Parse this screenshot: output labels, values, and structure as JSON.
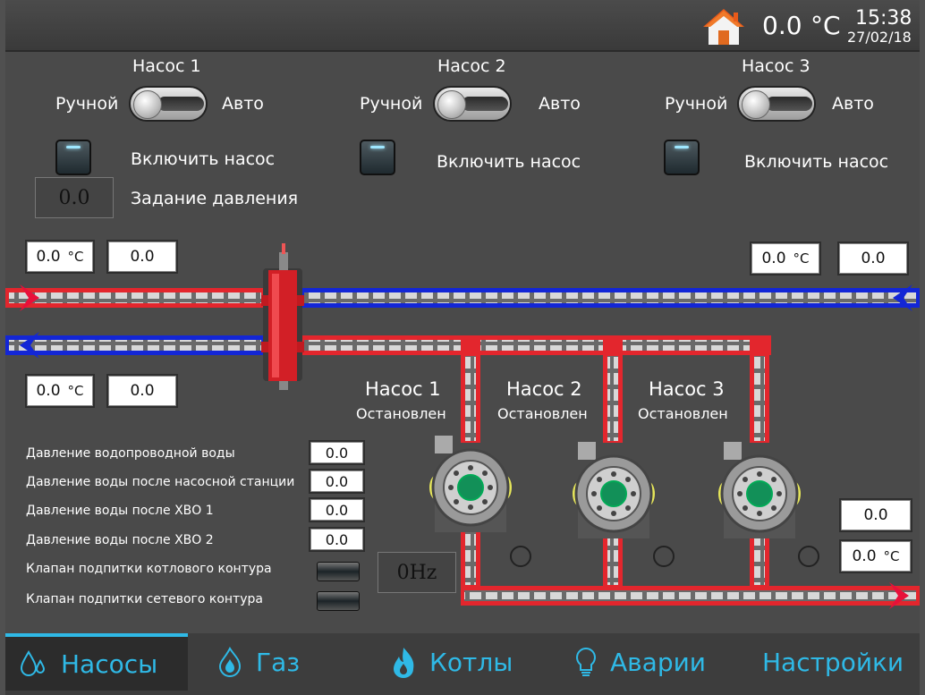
{
  "header": {
    "temperature": "0.0",
    "temp_unit": "°C",
    "time": "15:38",
    "date": "27/02/18"
  },
  "pumps_control": [
    {
      "title": "Насос 1",
      "manual": "Ручной",
      "auto": "Авто",
      "enable": "Включить насос"
    },
    {
      "title": "Насос 2",
      "manual": "Ручной",
      "auto": "Авто",
      "enable": "Включить насос"
    },
    {
      "title": "Насос 3",
      "manual": "Ручной",
      "auto": "Авто",
      "enable": "Включить насос"
    }
  ],
  "pressure_setpoint": {
    "label": "Задание давления",
    "value": "0.0"
  },
  "loop_readings": {
    "left_supply": {
      "temp": "0.0",
      "unit": "°C",
      "value": "0.0"
    },
    "left_return": {
      "temp": "0.0",
      "unit": "°C",
      "value": "0.0"
    },
    "right_return": {
      "temp": "0.0",
      "unit": "°C",
      "value": "0.0"
    },
    "outlet": {
      "value": "0.0",
      "temp": "0.0",
      "unit": "°C"
    }
  },
  "pump_status": [
    {
      "name": "Насос 1",
      "state": "Остановлен"
    },
    {
      "name": "Насос 2",
      "state": "Остановлен"
    },
    {
      "name": "Насос 3",
      "state": "Остановлен"
    }
  ],
  "sensors": [
    {
      "label": "Давление водопроводной воды",
      "value": "0.0"
    },
    {
      "label": "Давление воды после насосной станции",
      "value": "0.0"
    },
    {
      "label": "Давление воды после ХВО 1",
      "value": "0.0"
    },
    {
      "label": "Давление воды после ХВО 2",
      "value": "0.0"
    }
  ],
  "valves": [
    {
      "label": "Клапан подпитки котлового контура"
    },
    {
      "label": "Клапан подпитки сетевого контура"
    }
  ],
  "frequency": "0Hz",
  "nav": [
    {
      "label": "Насосы",
      "icon": "drops-icon",
      "active": true
    },
    {
      "label": "Газ",
      "icon": "gas-flame-icon",
      "active": false
    },
    {
      "label": "Котлы",
      "icon": "fire-icon",
      "active": false
    },
    {
      "label": "Аварии",
      "icon": "lightbulb-icon",
      "active": false
    },
    {
      "label": "Настройки",
      "icon": "",
      "active": false
    }
  ],
  "colors": {
    "accent": "#2fb9e6",
    "supply_pipe": "#e3262d",
    "return_pipe": "#1326d6",
    "panel": "#4a4a4a"
  }
}
